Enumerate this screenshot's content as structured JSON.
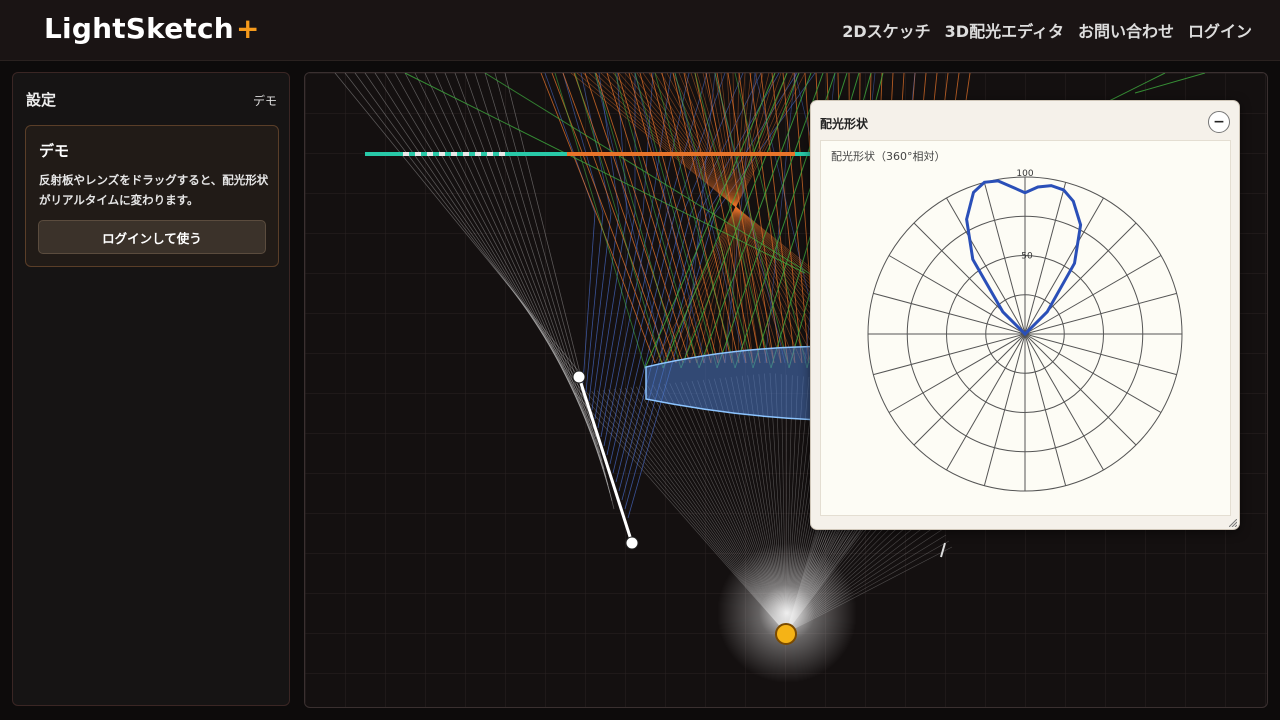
{
  "app": {
    "name": "LightSketch",
    "plus": "+"
  },
  "nav": {
    "items": [
      {
        "label": "2Dスケッチ",
        "name": "nav-2d-sketch"
      },
      {
        "label": "3D配光エディタ",
        "name": "nav-3d-editor"
      },
      {
        "label": "お問い合わせ",
        "name": "nav-contact"
      },
      {
        "label": "ログイン",
        "name": "nav-login"
      }
    ]
  },
  "sidebar": {
    "title": "設定",
    "mode": "デモ",
    "demo": {
      "title": "デモ",
      "description": "反射板やレンズをドラッグすると、配光形状がリアルタイムに変わります。",
      "button": "ログインして使う"
    }
  },
  "panel": {
    "title": "配光形状",
    "minimize": "−",
    "chart_label": "配光形状（360°相対）"
  },
  "colors": {
    "accent": "#f59a1c",
    "ray_orange": "#e8742a",
    "ray_blue": "#4a6fd0",
    "ray_green": "#3fae3f",
    "ray_white": "#cfcfcf",
    "lens": "#5b8fd8",
    "detector": "#28c9a8",
    "curve": "#2a4fb8",
    "source": "#f5b316"
  },
  "chart_data": {
    "type": "polar",
    "title": "配光形状（360°相対）",
    "radial_range": [
      0,
      100
    ],
    "radial_tick_labels": [
      "50",
      "100"
    ],
    "angular_step_deg": 15,
    "series": [
      {
        "angles_deg": [
          -45,
          -35,
          -27,
          -20,
          -15,
          -10,
          -5,
          0,
          5,
          10,
          15,
          20,
          27,
          35,
          45
        ],
        "values": [
          20,
          58,
          82,
          96,
          100,
          99,
          94,
          90,
          94,
          96,
          95,
          90,
          78,
          55,
          20
        ]
      }
    ]
  }
}
